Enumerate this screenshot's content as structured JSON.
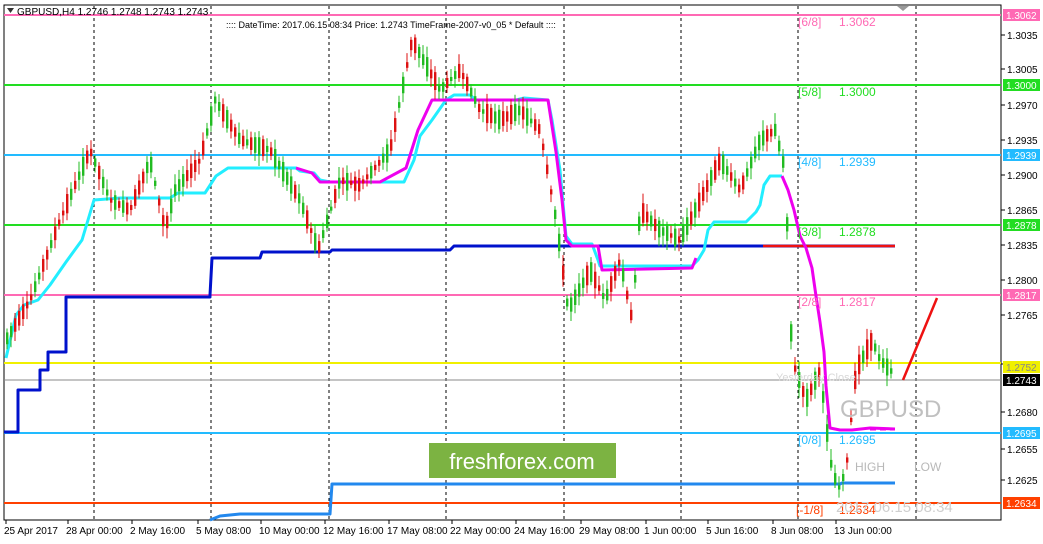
{
  "header": {
    "symbol_info": "GBPUSD,H4  1.2746 1.2748 1.2743 1.2743",
    "indicator_text": ":::: DateTime: 2017.06.15 08:34    Price: 1.2743    TimeFrame-2007-v0_05    *    Default    ::::"
  },
  "watermark": {
    "symbol": "GBPUSD",
    "datetime": "2017.06.15 08:34",
    "high_label": "HIGH",
    "low_label": "LOW",
    "faint_label": "Yesterday Close",
    "brand": "freshforex.com"
  },
  "colors": {
    "murrey_pink": "#ff69b4",
    "murrey_green": "#22dd22",
    "murrey_cyan": "#22bbff",
    "yellow_line": "#f0f000",
    "orange_line": "#ff4000",
    "magenta_line": "#ee00ee",
    "aqua_line": "#22eeff",
    "navy_line": "#0011cc",
    "blue_line": "#2288ee",
    "red_line": "#ee1111",
    "candle_up": "#22bb22",
    "candle_down": "#dd1111",
    "brand_bg": "#7cb342"
  },
  "murrey_levels": [
    {
      "tag": "[6/8]",
      "value": "1.3062",
      "color": "#ff69b4"
    },
    {
      "tag": "[5/8]",
      "value": "1.3000",
      "color": "#22dd22"
    },
    {
      "tag": "[4/8]",
      "value": "1.2939",
      "color": "#22bbff"
    },
    {
      "tag": "[3/8]",
      "value": "1.2878",
      "color": "#22dd22"
    },
    {
      "tag": "[2/8]",
      "value": "1.2817",
      "color": "#ff69b4"
    },
    {
      "tag": "[0/8]",
      "value": "1.2695",
      "color": "#22bbff"
    },
    {
      "tag": "[-1/8]",
      "value": "1.2634",
      "color": "#ff4000"
    }
  ],
  "price_axis": {
    "ticks": [
      "1.3035",
      "1.3005",
      "1.2970",
      "1.2935",
      "1.2900",
      "1.2865",
      "1.2835",
      "1.2800",
      "1.2765",
      "1.2715",
      "1.2680",
      "1.2655",
      "1.2625"
    ],
    "badges": [
      {
        "label": "1.3062",
        "bg": "#ff69b4"
      },
      {
        "label": "1.3000",
        "bg": "#22dd22"
      },
      {
        "label": "1.2939",
        "bg": "#22bbff"
      },
      {
        "label": "1.2878",
        "bg": "#22dd22"
      },
      {
        "label": "1.2817",
        "bg": "#ff69b4"
      },
      {
        "label": "1.2752",
        "bg": "#f0f000"
      },
      {
        "label": "1.2743",
        "bg": "#000000"
      },
      {
        "label": "1.2695",
        "bg": "#22bbff"
      },
      {
        "label": "1.2634",
        "bg": "#ff4000"
      }
    ]
  },
  "time_axis": {
    "labels": [
      "25 Apr 2017",
      "28 Apr 00:00",
      "2 May 16:00",
      "5 May 08:00",
      "10 May 00:00",
      "12 May 16:00",
      "17 May 08:00",
      "22 May 00:00",
      "24 May 16:00",
      "29 May 08:00",
      "1 Jun 00:00",
      "5 Jun 16:00",
      "8 Jun 08:00",
      "13 Jun 00:00"
    ]
  }
}
